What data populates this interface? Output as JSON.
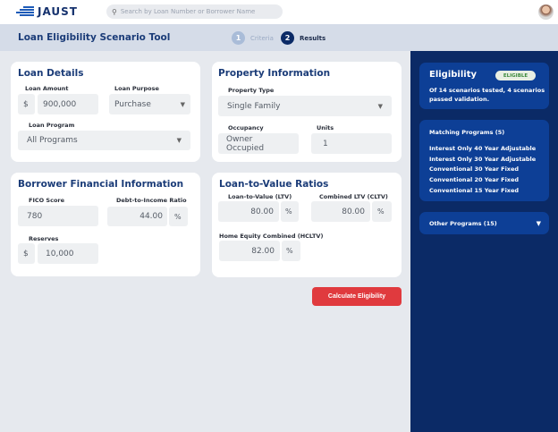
{
  "header": {
    "logo": "JAUST",
    "search_placeholder": "Search by Loan Number or Borrower Name"
  },
  "subheader": {
    "title": "Loan Eligibility Scenario Tool",
    "steps": [
      {
        "num": "1",
        "label": "Criteria"
      },
      {
        "num": "2",
        "label": "Results"
      }
    ]
  },
  "loan_details": {
    "title": "Loan Details",
    "amount_label": "Loan Amount",
    "amount_prefix": "$",
    "amount": "900,000",
    "purpose_label": "Loan Purpose",
    "purpose": "Purchase",
    "program_label": "Loan Program",
    "program": "All Programs"
  },
  "property": {
    "title": "Property Information",
    "type_label": "Property Type",
    "type": "Single Family",
    "occupancy_label": "Occupancy",
    "occupancy": "Owner Occupied",
    "units_label": "Units",
    "units": "1"
  },
  "borrower": {
    "title": "Borrower Financial Information",
    "fico_label": "FICO Score",
    "fico": "780",
    "dti_label": "Debt-to-Income Ratio",
    "dti": "44.00",
    "pct": "%",
    "reserves_label": "Reserves",
    "reserves_prefix": "$",
    "reserves": "10,000"
  },
  "ltv": {
    "title": "Loan-to-Value Ratios",
    "ltv_label": "Loan-to-Value (LTV)",
    "ltv": "80.00",
    "cltv_label": "Combined LTV (CLTV)",
    "cltv": "80.00",
    "hcltv_label": "Home Equity Combined (HCLTV)",
    "hcltv": "82.00",
    "pct": "%"
  },
  "calculate_label": "Calculate Eligibility",
  "sidebar": {
    "eligibility_title": "Eligibility",
    "badge": "ELIGIBLE",
    "summary": "Of 14 scenarios tested, 4 scenarios passed validation.",
    "matching_title": "Matching Programs (5)",
    "programs": [
      "Interest Only 40 Year Adjustable",
      "Interest Only 30 Year Adjustable",
      "Conventional 30 Year Fixed",
      "Conventional 20 Year Fixed",
      "Conventional 15 Year Fixed"
    ],
    "other_title": "Other Programs (15)"
  },
  "colors": {
    "navy": "#0b2a66",
    "card_blue": "#0d3f96",
    "accent_red": "#e03a3e",
    "badge_green": "#3c8a3c"
  }
}
